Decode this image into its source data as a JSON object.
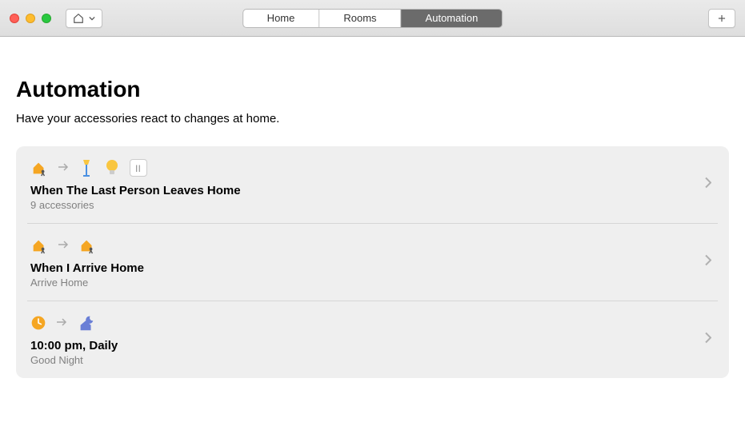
{
  "toolbar": {
    "tabs": [
      "Home",
      "Rooms",
      "Automation"
    ],
    "active_tab": "Automation"
  },
  "page": {
    "title": "Automation",
    "subtitle": "Have your accessories react to changes at home."
  },
  "automations": [
    {
      "title": "When The Last Person Leaves Home",
      "subtitle": "9 accessories",
      "trigger_icon": "house-leave",
      "action_icons": [
        "floor-lamp",
        "bulb",
        "switch"
      ]
    },
    {
      "title": "When I Arrive Home",
      "subtitle": "Arrive Home",
      "trigger_icon": "house-arrive",
      "action_icons": [
        "house-arrive"
      ]
    },
    {
      "title": "10:00 pm, Daily",
      "subtitle": "Good Night",
      "trigger_icon": "clock",
      "action_icons": [
        "night-house"
      ]
    }
  ]
}
